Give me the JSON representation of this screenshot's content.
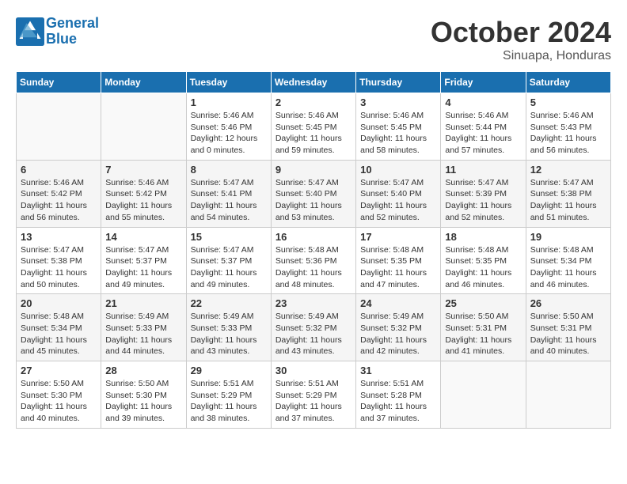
{
  "header": {
    "logo_line1": "General",
    "logo_line2": "Blue",
    "month": "October 2024",
    "location": "Sinuapa, Honduras"
  },
  "days_of_week": [
    "Sunday",
    "Monday",
    "Tuesday",
    "Wednesday",
    "Thursday",
    "Friday",
    "Saturday"
  ],
  "weeks": [
    [
      {
        "day": "",
        "info": ""
      },
      {
        "day": "",
        "info": ""
      },
      {
        "day": "1",
        "info": "Sunrise: 5:46 AM\nSunset: 5:46 PM\nDaylight: 12 hours\nand 0 minutes."
      },
      {
        "day": "2",
        "info": "Sunrise: 5:46 AM\nSunset: 5:45 PM\nDaylight: 11 hours\nand 59 minutes."
      },
      {
        "day": "3",
        "info": "Sunrise: 5:46 AM\nSunset: 5:45 PM\nDaylight: 11 hours\nand 58 minutes."
      },
      {
        "day": "4",
        "info": "Sunrise: 5:46 AM\nSunset: 5:44 PM\nDaylight: 11 hours\nand 57 minutes."
      },
      {
        "day": "5",
        "info": "Sunrise: 5:46 AM\nSunset: 5:43 PM\nDaylight: 11 hours\nand 56 minutes."
      }
    ],
    [
      {
        "day": "6",
        "info": "Sunrise: 5:46 AM\nSunset: 5:42 PM\nDaylight: 11 hours\nand 56 minutes."
      },
      {
        "day": "7",
        "info": "Sunrise: 5:46 AM\nSunset: 5:42 PM\nDaylight: 11 hours\nand 55 minutes."
      },
      {
        "day": "8",
        "info": "Sunrise: 5:47 AM\nSunset: 5:41 PM\nDaylight: 11 hours\nand 54 minutes."
      },
      {
        "day": "9",
        "info": "Sunrise: 5:47 AM\nSunset: 5:40 PM\nDaylight: 11 hours\nand 53 minutes."
      },
      {
        "day": "10",
        "info": "Sunrise: 5:47 AM\nSunset: 5:40 PM\nDaylight: 11 hours\nand 52 minutes."
      },
      {
        "day": "11",
        "info": "Sunrise: 5:47 AM\nSunset: 5:39 PM\nDaylight: 11 hours\nand 52 minutes."
      },
      {
        "day": "12",
        "info": "Sunrise: 5:47 AM\nSunset: 5:38 PM\nDaylight: 11 hours\nand 51 minutes."
      }
    ],
    [
      {
        "day": "13",
        "info": "Sunrise: 5:47 AM\nSunset: 5:38 PM\nDaylight: 11 hours\nand 50 minutes."
      },
      {
        "day": "14",
        "info": "Sunrise: 5:47 AM\nSunset: 5:37 PM\nDaylight: 11 hours\nand 49 minutes."
      },
      {
        "day": "15",
        "info": "Sunrise: 5:47 AM\nSunset: 5:37 PM\nDaylight: 11 hours\nand 49 minutes."
      },
      {
        "day": "16",
        "info": "Sunrise: 5:48 AM\nSunset: 5:36 PM\nDaylight: 11 hours\nand 48 minutes."
      },
      {
        "day": "17",
        "info": "Sunrise: 5:48 AM\nSunset: 5:35 PM\nDaylight: 11 hours\nand 47 minutes."
      },
      {
        "day": "18",
        "info": "Sunrise: 5:48 AM\nSunset: 5:35 PM\nDaylight: 11 hours\nand 46 minutes."
      },
      {
        "day": "19",
        "info": "Sunrise: 5:48 AM\nSunset: 5:34 PM\nDaylight: 11 hours\nand 46 minutes."
      }
    ],
    [
      {
        "day": "20",
        "info": "Sunrise: 5:48 AM\nSunset: 5:34 PM\nDaylight: 11 hours\nand 45 minutes."
      },
      {
        "day": "21",
        "info": "Sunrise: 5:49 AM\nSunset: 5:33 PM\nDaylight: 11 hours\nand 44 minutes."
      },
      {
        "day": "22",
        "info": "Sunrise: 5:49 AM\nSunset: 5:33 PM\nDaylight: 11 hours\nand 43 minutes."
      },
      {
        "day": "23",
        "info": "Sunrise: 5:49 AM\nSunset: 5:32 PM\nDaylight: 11 hours\nand 43 minutes."
      },
      {
        "day": "24",
        "info": "Sunrise: 5:49 AM\nSunset: 5:32 PM\nDaylight: 11 hours\nand 42 minutes."
      },
      {
        "day": "25",
        "info": "Sunrise: 5:50 AM\nSunset: 5:31 PM\nDaylight: 11 hours\nand 41 minutes."
      },
      {
        "day": "26",
        "info": "Sunrise: 5:50 AM\nSunset: 5:31 PM\nDaylight: 11 hours\nand 40 minutes."
      }
    ],
    [
      {
        "day": "27",
        "info": "Sunrise: 5:50 AM\nSunset: 5:30 PM\nDaylight: 11 hours\nand 40 minutes."
      },
      {
        "day": "28",
        "info": "Sunrise: 5:50 AM\nSunset: 5:30 PM\nDaylight: 11 hours\nand 39 minutes."
      },
      {
        "day": "29",
        "info": "Sunrise: 5:51 AM\nSunset: 5:29 PM\nDaylight: 11 hours\nand 38 minutes."
      },
      {
        "day": "30",
        "info": "Sunrise: 5:51 AM\nSunset: 5:29 PM\nDaylight: 11 hours\nand 37 minutes."
      },
      {
        "day": "31",
        "info": "Sunrise: 5:51 AM\nSunset: 5:28 PM\nDaylight: 11 hours\nand 37 minutes."
      },
      {
        "day": "",
        "info": ""
      },
      {
        "day": "",
        "info": ""
      }
    ]
  ]
}
